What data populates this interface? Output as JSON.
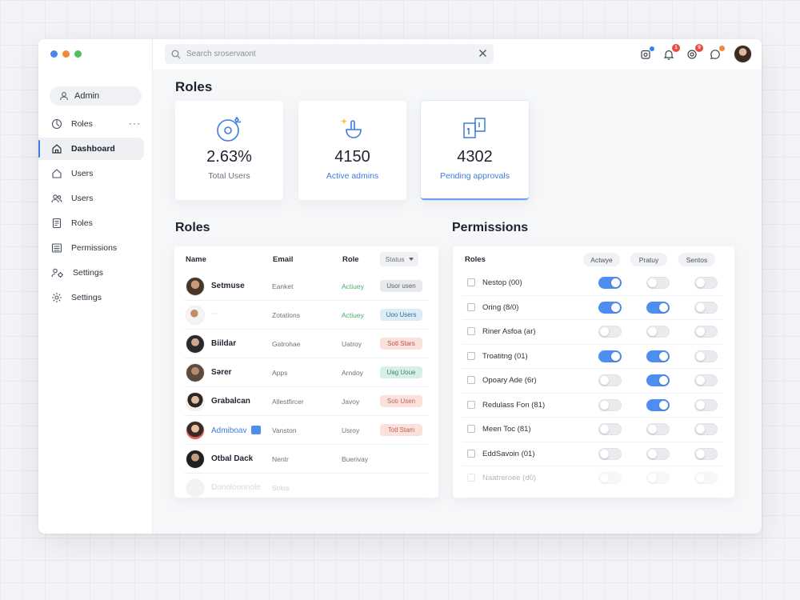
{
  "colors": {
    "accent": "#3f7be8",
    "dot_blue": "#4a86e8",
    "dot_orange": "#f0883e",
    "dot_green": "#4cc05a"
  },
  "sidebar": {
    "admin_label": "Admin",
    "items": [
      {
        "label": "Roles",
        "icon": "cloud-icon",
        "more": "···"
      },
      {
        "label": "Dashboard",
        "icon": "home-icon",
        "active": true
      },
      {
        "label": "Users",
        "icon": "home-icon"
      },
      {
        "label": "Users",
        "icon": "users-icon"
      },
      {
        "label": "Roles",
        "icon": "document-icon"
      },
      {
        "label": "Permissions",
        "icon": "list-icon"
      },
      {
        "label": "Settings",
        "icon": "users-settings-icon"
      },
      {
        "label": "Settings",
        "icon": "gear-icon"
      }
    ]
  },
  "topbar": {
    "search_placeholder": "Search sroservaont",
    "badges": {
      "bell": "1",
      "settings": "9"
    }
  },
  "page_title": "Roles",
  "stats": [
    {
      "value": "2.63%",
      "label": "Total Users",
      "icon": "target-icon"
    },
    {
      "value": "4150",
      "label": "Active admins",
      "icon": "thumbs-up-icon"
    },
    {
      "value": "4302",
      "label": "Pending approvals",
      "icon": "approval-icon"
    }
  ],
  "roles_section": {
    "title": "Roles",
    "columns": {
      "name": "Name",
      "email": "Email",
      "role": "Role",
      "status": "Status"
    },
    "rows": [
      {
        "name": "Setmuse",
        "email": "Eanket",
        "role": "Actiuey",
        "status": "Usor usen"
      },
      {
        "name": "",
        "email": "Zotations",
        "role": "Actiuey",
        "status": "Uoo Users"
      },
      {
        "name": "Biildar",
        "email": "Gatrohae",
        "role": "Uatroy",
        "status": "Sotl Stars"
      },
      {
        "name": "Sərer",
        "email": "Apps",
        "role": "Arndoy",
        "status": "Uag Uoue"
      },
      {
        "name": "Grabalcan",
        "email": "Allestfircer",
        "role": "Javoy",
        "status": "Sotı Usen"
      },
      {
        "name": "Admiboav",
        "email": "Vanston",
        "role": "Usroy",
        "status": "Totl Stam"
      },
      {
        "name": "Otbal Dack",
        "email": "Nentr",
        "role": "Buerivay",
        "status": ""
      },
      {
        "name": "Donoloonnole",
        "email": "Sotos",
        "role": "",
        "status": ""
      }
    ]
  },
  "permissions_section": {
    "title": "Permissions",
    "columns": {
      "roles": "Roles",
      "c1": "Actwye",
      "c2": "Pratuy",
      "c3": "Sentos"
    },
    "rows": [
      {
        "label": "Nestop (00)",
        "toggles": [
          true,
          false,
          false
        ]
      },
      {
        "label": "Oring (8/0)",
        "toggles": [
          true,
          true,
          false
        ]
      },
      {
        "label": "Riner Asfoa (ar)",
        "toggles": [
          false,
          false,
          false
        ]
      },
      {
        "label": "Troatitng (01)",
        "toggles": [
          true,
          true,
          false
        ]
      },
      {
        "label": "Opoary Ade (6r)",
        "toggles": [
          false,
          true,
          false
        ]
      },
      {
        "label": "Redulass Fon (81)",
        "toggles": [
          false,
          true,
          false
        ]
      },
      {
        "label": "Meen Toc (81)",
        "toggles": [
          false,
          false,
          false
        ]
      },
      {
        "label": "EddSavoin (01)",
        "toggles": [
          false,
          false,
          false
        ]
      },
      {
        "label": "Naatreroee (d0)",
        "toggles": [
          false,
          false,
          false
        ]
      }
    ]
  }
}
